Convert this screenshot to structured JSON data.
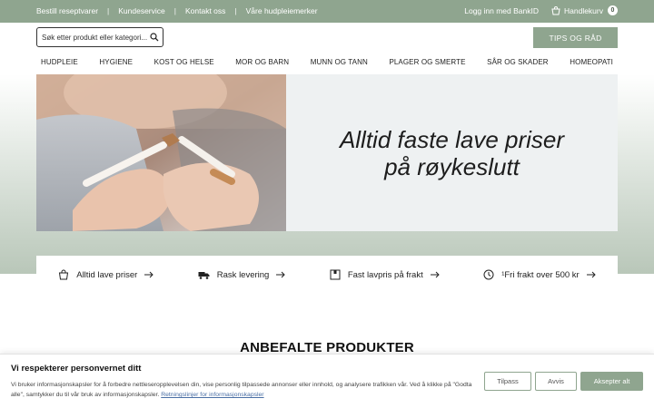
{
  "topbar": {
    "links": [
      "Bestill reseptvarer",
      "Kundeservice",
      "Kontakt oss",
      "Våre hudpleiemerker"
    ],
    "login": "Logg inn med BankID",
    "cart_label": "Handlekurv",
    "cart_count": "0"
  },
  "header": {
    "search_placeholder": "Søk etter produkt eller kategori...",
    "tips_button": "TIPS OG RÅD"
  },
  "nav": {
    "items": [
      "HUDPLEIE",
      "HYGIENE",
      "KOST OG HELSE",
      "MOR OG BARN",
      "MUNN OG TANN",
      "PLAGER OG SMERTE",
      "SÅR OG SKADER",
      "HOMEOPATI"
    ]
  },
  "hero": {
    "line1": "Alltid faste lave priser",
    "line2": "på røykeslutt"
  },
  "usp": [
    {
      "label": "Alltid lave priser",
      "icon": "shopping-bag-icon"
    },
    {
      "label": "Rask levering",
      "icon": "truck-icon"
    },
    {
      "label": "Fast lavpris på frakt",
      "icon": "package-icon"
    },
    {
      "label": "¹Fri frakt over 500 kr",
      "icon": "clock-icon"
    }
  ],
  "recommended": {
    "title": "ANBEFALTE PRODUKTER"
  },
  "cookie": {
    "title": "Vi respekterer personvernet ditt",
    "text": "Vi bruker informasjonskapsler for å forbedre nettleseropplevelsen din, vise personlig tilpassede annonser eller innhold, og analysere trafikken vår. Ved å klikke på \"Godta alle\", samtykker du til vår bruk av informasjonskapsler.",
    "link": "Retningslinjer for informasjonskapsler",
    "customize": "Tilpass",
    "reject": "Avvis",
    "accept": "Aksepter alt"
  },
  "colors": {
    "brand_green": "#8fa58f",
    "hero_panel": "#eef1f2"
  }
}
